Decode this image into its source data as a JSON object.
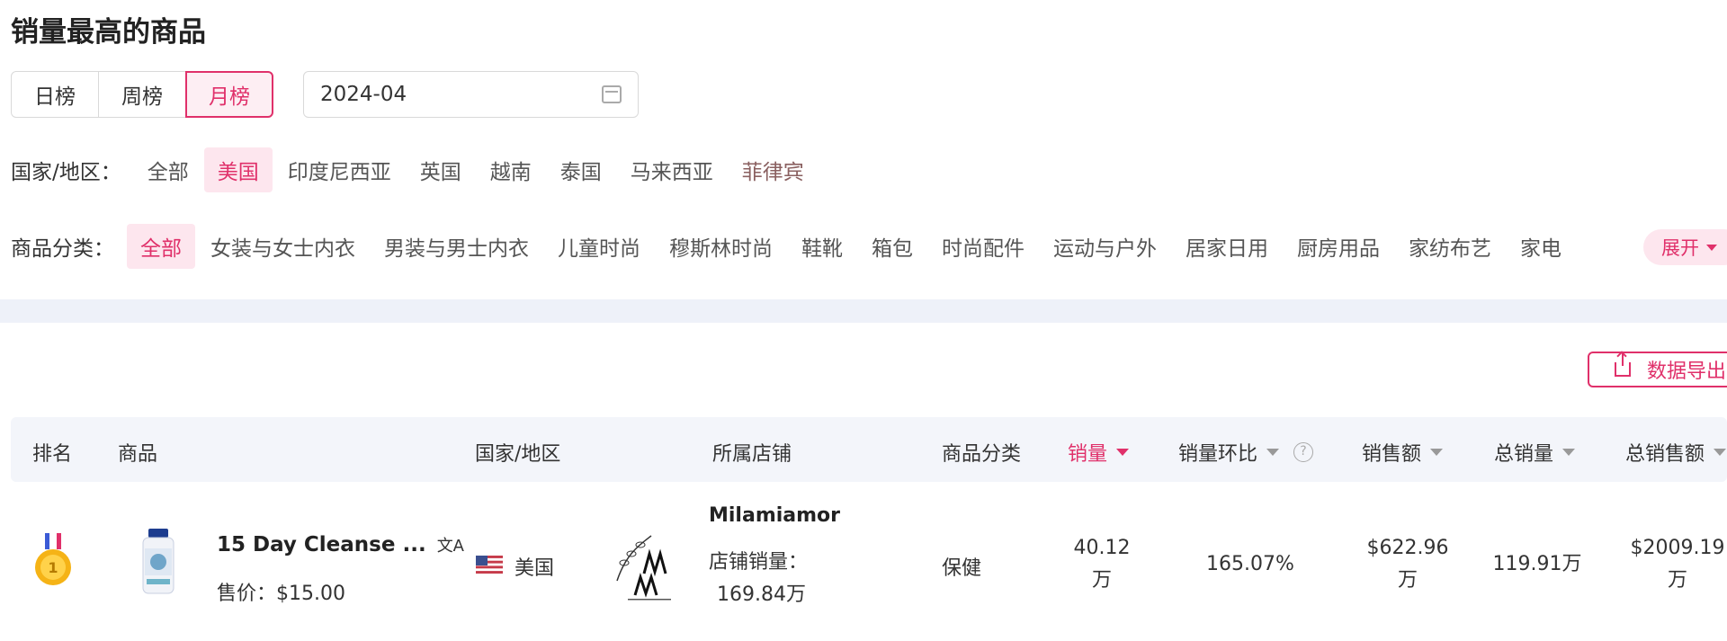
{
  "page_title": "销量最高的商品",
  "period_tabs": [
    {
      "label": "日榜",
      "active": false
    },
    {
      "label": "周榜",
      "active": false
    },
    {
      "label": "月榜",
      "active": true
    }
  ],
  "date_value": "2024-04",
  "country_filter": {
    "label": "国家/地区：",
    "options": [
      "全部",
      "美国",
      "印度尼西亚",
      "英国",
      "越南",
      "泰国",
      "马来西亚",
      "菲律宾"
    ],
    "selected": "美国"
  },
  "category_filter": {
    "label": "商品分类：",
    "options": [
      "全部",
      "女装与女士内衣",
      "男装与男士内衣",
      "儿童时尚",
      "穆斯林时尚",
      "鞋靴",
      "箱包",
      "时尚配件",
      "运动与户外",
      "居家日用",
      "厨房用品",
      "家纺布艺",
      "家电"
    ],
    "selected": "全部",
    "expand_label": "展开"
  },
  "export_label": "数据导出",
  "table": {
    "headers": {
      "rank": "排名",
      "product": "商品",
      "country": "国家/地区",
      "shop": "所属店铺",
      "category": "商品分类",
      "sales": "销量",
      "sales_mom": "销量环比",
      "revenue": "销售额",
      "total_sales": "总销量",
      "total_revenue": "总销售额"
    },
    "rows": [
      {
        "rank": 1,
        "medal_number": "1",
        "product_name": "15 Day Cleanse ...",
        "price": "售价：$15.00",
        "country": "美国",
        "shop_name": "Milamiamor",
        "shop_sales_label": "店铺销量：",
        "shop_sales_value": "169.84万",
        "category": "保健",
        "sales_line1": "40.12",
        "sales_line2": "万",
        "sales_mom": "165.07%",
        "revenue_line1": "$622.96",
        "revenue_line2": "万",
        "total_sales": "119.91万",
        "total_revenue_line1": "$2009.19",
        "total_revenue_line2": "万"
      }
    ]
  },
  "colors": {
    "accent": "#e0306a",
    "accent_bg": "#fde6ee",
    "header_bg": "#f3f5fa",
    "band_bg": "#eef1f9"
  }
}
